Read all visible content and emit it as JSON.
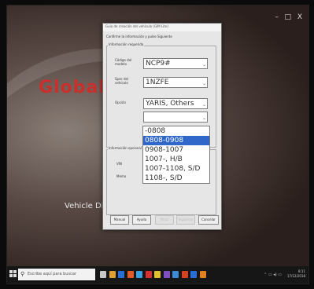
{
  "window": {
    "minimize": "–",
    "maximize": "□",
    "close": "X"
  },
  "background": {
    "brand_text": "Global T",
    "subtitle": "Vehicle Diag"
  },
  "dialog": {
    "title": "Guía de creación del vehículo (GIM Lite)",
    "heading": "Confirme la información y pulse Siguiente",
    "section_required": "Información requerida",
    "fields": [
      {
        "label": "Código del modelo",
        "value": "NCP9#"
      },
      {
        "label": "Spec del vehículo",
        "value": "1NZFE"
      },
      {
        "label": "Opción",
        "value": "YARIS, Others"
      },
      {
        "label": "",
        "value": ""
      }
    ],
    "section_optional": "Información opcional",
    "optional_labels": [
      "VIN",
      "Memo"
    ],
    "buttons": {
      "manual": "Manual",
      "help": "Ayuda",
      "back": "Atrás",
      "next": "Siguiente",
      "cancel": "Cancelar"
    }
  },
  "dropdown": {
    "options": [
      "-0808",
      "0808-0908",
      "0908-1007",
      "1007-, H/B",
      "1007-1108, S/D",
      "1108-, S/D"
    ],
    "selected_index": 1
  },
  "taskbar": {
    "search_placeholder": "Escribe aquí para buscar",
    "clock_time": "8:11",
    "clock_date": "17/12/2018",
    "icon_colors": [
      "#c8c8c8",
      "#e0a030",
      "#2a6fd6",
      "#e05a2a",
      "#3aa0e0",
      "#d83030",
      "#e0c030",
      "#8050c0",
      "#3a8ad8",
      "#d84020",
      "#2a6fd6",
      "#e08020"
    ]
  }
}
